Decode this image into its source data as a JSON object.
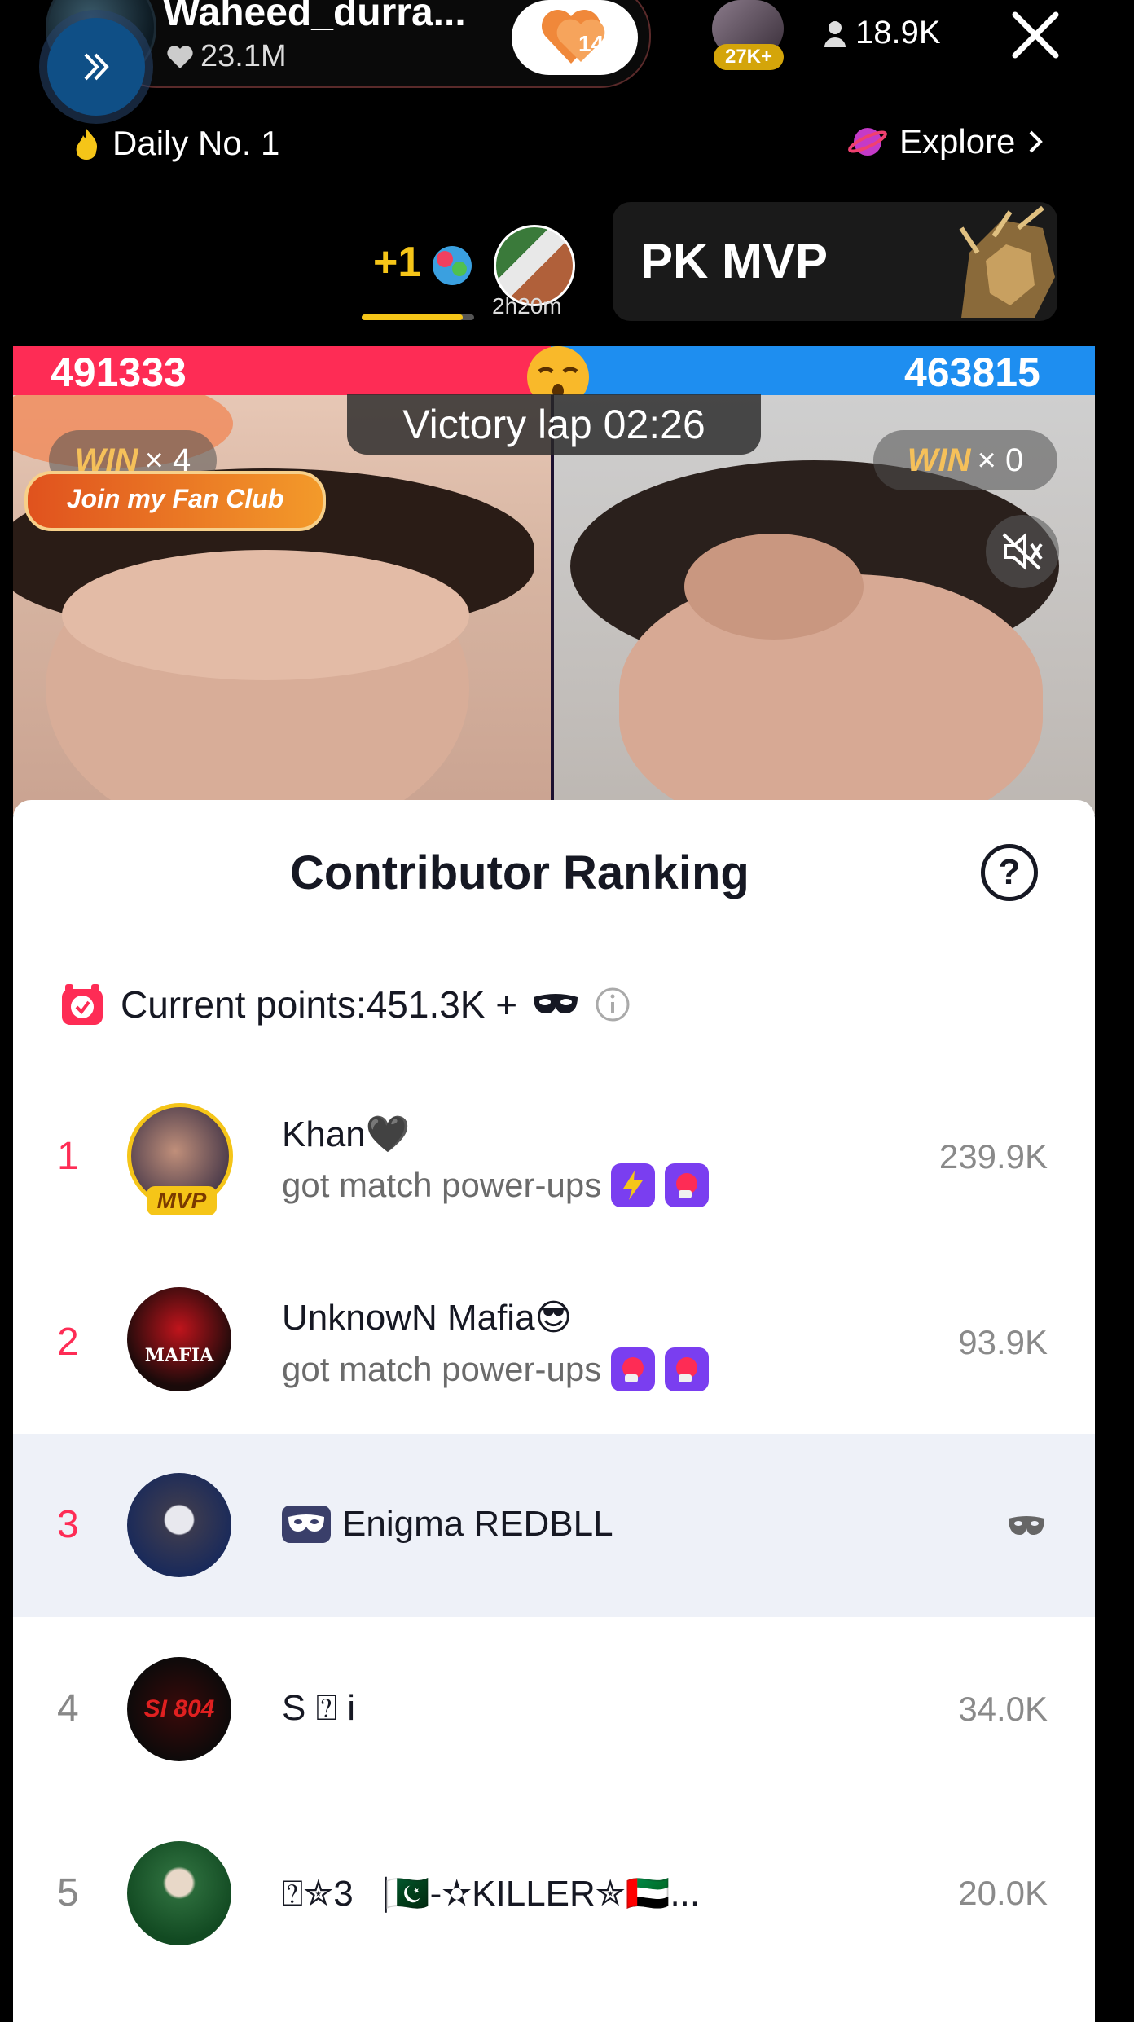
{
  "host": {
    "name": "Waheed_durra...",
    "likes": "23.1M",
    "follow_count": "14"
  },
  "top_viewer_badge": "27K+",
  "viewer_count": "18.9K",
  "daily_rank": "Daily No. 1",
  "explore_label": "Explore",
  "gift_counter": "+1",
  "mvp_timer": "2h20m",
  "mvp_progress": 0.9,
  "pk_banner_title": "PK MVP",
  "score": {
    "left": "491333",
    "right": "463815"
  },
  "victory_lap": "Victory lap 02:26",
  "win_left": {
    "label": "WIN",
    "count": "× 4"
  },
  "win_right": {
    "label": "WIN",
    "count": "× 0"
  },
  "fan_club_label": "Join my Fan Club",
  "panel": {
    "title": "Contributor Ranking",
    "current_points": "Current points:451.3K +",
    "mvp_tag": "MVP"
  },
  "ranking": [
    {
      "rank": "1",
      "name": "Khan🖤",
      "subtitle": "got match power-ups",
      "score": "239.9K"
    },
    {
      "rank": "2",
      "name": "UnknowN Mafia😎",
      "subtitle": "got match power-ups",
      "score": "93.9K"
    },
    {
      "rank": "3",
      "name": "Enigma REDBLL",
      "subtitle": "",
      "score": ""
    },
    {
      "rank": "4",
      "name": "S ⍰ i",
      "subtitle": "",
      "score": "34.0K"
    },
    {
      "rank": "5",
      "name": "⍰✮3⎹🇵🇰-✫KILLER✮🇦🇪...",
      "subtitle": "",
      "score": "20.0K"
    }
  ],
  "avatar_labels": {
    "rank2": "MAFIA",
    "rank4": "SI 804"
  },
  "colors": {
    "accent_red": "#fe2c55",
    "accent_blue": "#1e8ef0",
    "gold": "#f5c518",
    "powerup_purple": "#7a3ef0"
  }
}
